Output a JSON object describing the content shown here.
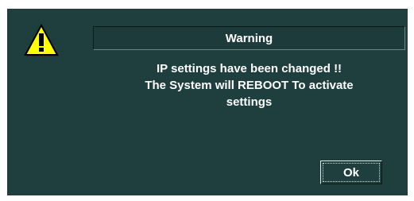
{
  "dialog": {
    "title": "Warning",
    "message_lines": [
      "IP settings have been changed !!",
      "The System will REBOOT To activate",
      "settings"
    ],
    "ok_label": "Ok",
    "icon": "warning-triangle-icon"
  },
  "colors": {
    "background": "#1f3f3f",
    "text": "#ffffff",
    "icon_fill": "#ffff00"
  }
}
